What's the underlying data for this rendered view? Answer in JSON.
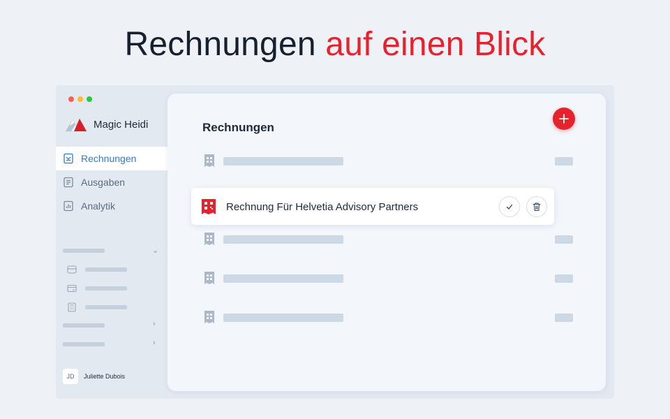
{
  "headline": {
    "part1": "Rechnungen",
    "part2": "auf einen Blick"
  },
  "app": {
    "name": "Magic Heidi"
  },
  "sidebar": {
    "items": [
      {
        "label": "Rechnungen",
        "icon": "invoice-icon",
        "active": true
      },
      {
        "label": "Ausgaben",
        "icon": "receipt-icon",
        "active": false
      },
      {
        "label": "Analytik",
        "icon": "chart-icon",
        "active": false
      }
    ]
  },
  "user": {
    "initials": "JD",
    "name": "Juliette Dubois"
  },
  "main": {
    "title": "Rechnungen",
    "highlighted_invoice": "Rechnung Für Helvetia Advisory Partners"
  },
  "colors": {
    "accent": "#e5232d",
    "active_nav": "#2f7bd8",
    "placeholder": "#cdd8e5"
  }
}
